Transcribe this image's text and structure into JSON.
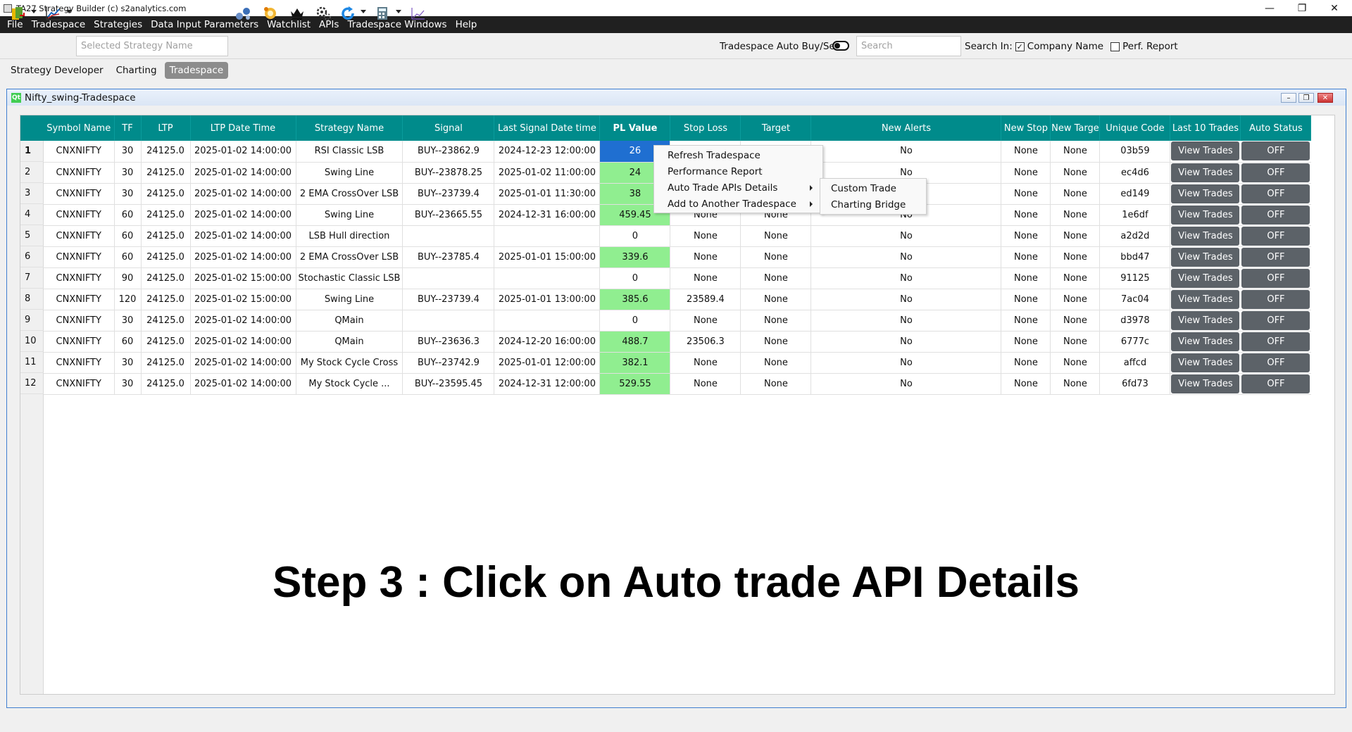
{
  "window": {
    "title": "TA27 Strategy Builder (c) s2analytics.com"
  },
  "menu": [
    "File",
    "Tradespace",
    "Strategies",
    "Data Input Parameters",
    "Watchlist",
    "APIs",
    "Tradespace Windows",
    "Help"
  ],
  "toolbar": {
    "strategy_placeholder": "Selected Strategy Name",
    "auto_label": "Tradespace Auto Buy/Sell:",
    "search_placeholder": "Search",
    "search_in_label": "Search In:",
    "company_name_label": "Company Name",
    "perf_report_label": "Perf. Report"
  },
  "tabs": [
    "Strategy Developer",
    "Charting",
    "Tradespace"
  ],
  "subwindow": {
    "title": "Nifty_swing-Tradespace"
  },
  "columns": [
    "Symbol Name",
    "TF",
    "LTP",
    "LTP Date Time",
    "Strategy Name",
    "Signal",
    "Last Signal Date time",
    "PL Value",
    "Stop Loss",
    "Target",
    "New Alerts",
    "New Stop",
    "New Targe",
    "Unique Code",
    "Last 10 Trades",
    "Auto Status"
  ],
  "rows": [
    {
      "n": "1",
      "sym": "CNXNIFTY",
      "tf": "30",
      "ltp": "24125.0",
      "ltpdt": "2025-01-02 14:00:00",
      "strat": "RSI Classic LSB",
      "sig": "BUY--23862.9",
      "lsdt": "2024-12-23 12:00:00",
      "pl": "26",
      "sl": "",
      "tg": "",
      "alert": "No",
      "nstop": "None",
      "ntarget": "None",
      "code": "03b59",
      "trades": "View Trades",
      "auto": "OFF"
    },
    {
      "n": "2",
      "sym": "CNXNIFTY",
      "tf": "30",
      "ltp": "24125.0",
      "ltpdt": "2025-01-02 14:00:00",
      "strat": "Swing Line",
      "sig": "BUY--23878.25",
      "lsdt": "2025-01-02 11:00:00",
      "pl": "24",
      "sl": "",
      "tg": "",
      "alert": "No",
      "nstop": "None",
      "ntarget": "None",
      "code": "ec4d6",
      "trades": "View Trades",
      "auto": "OFF"
    },
    {
      "n": "3",
      "sym": "CNXNIFTY",
      "tf": "30",
      "ltp": "24125.0",
      "ltpdt": "2025-01-02 14:00:00",
      "strat": "2 EMA CrossOver LSB",
      "sig": "BUY--23739.4",
      "lsdt": "2025-01-01 11:30:00",
      "pl": "38",
      "sl": "",
      "tg": "",
      "alert": "o",
      "nstop": "None",
      "ntarget": "None",
      "code": "ed149",
      "trades": "View Trades",
      "auto": "OFF"
    },
    {
      "n": "4",
      "sym": "CNXNIFTY",
      "tf": "60",
      "ltp": "24125.0",
      "ltpdt": "2025-01-02 14:00:00",
      "strat": "Swing Line",
      "sig": "BUY--23665.55",
      "lsdt": "2024-12-31 16:00:00",
      "pl": "459.45",
      "sl": "None",
      "tg": "None",
      "alert": "No",
      "nstop": "None",
      "ntarget": "None",
      "code": "1e6df",
      "trades": "View Trades",
      "auto": "OFF"
    },
    {
      "n": "5",
      "sym": "CNXNIFTY",
      "tf": "60",
      "ltp": "24125.0",
      "ltpdt": "2025-01-02 14:00:00",
      "strat": "LSB Hull direction",
      "sig": "",
      "lsdt": "",
      "pl": "0",
      "sl": "None",
      "tg": "None",
      "alert": "No",
      "nstop": "None",
      "ntarget": "None",
      "code": "a2d2d",
      "trades": "View Trades",
      "auto": "OFF"
    },
    {
      "n": "6",
      "sym": "CNXNIFTY",
      "tf": "60",
      "ltp": "24125.0",
      "ltpdt": "2025-01-02 14:00:00",
      "strat": "2 EMA CrossOver LSB",
      "sig": "BUY--23785.4",
      "lsdt": "2025-01-01 15:00:00",
      "pl": "339.6",
      "sl": "None",
      "tg": "None",
      "alert": "No",
      "nstop": "None",
      "ntarget": "None",
      "code": "bbd47",
      "trades": "View Trades",
      "auto": "OFF"
    },
    {
      "n": "7",
      "sym": "CNXNIFTY",
      "tf": "90",
      "ltp": "24125.0",
      "ltpdt": "2025-01-02 15:00:00",
      "strat": "Stochastic Classic LSB",
      "sig": "",
      "lsdt": "",
      "pl": "0",
      "sl": "None",
      "tg": "None",
      "alert": "No",
      "nstop": "None",
      "ntarget": "None",
      "code": "91125",
      "trades": "View Trades",
      "auto": "OFF"
    },
    {
      "n": "8",
      "sym": "CNXNIFTY",
      "tf": "120",
      "ltp": "24125.0",
      "ltpdt": "2025-01-02 15:00:00",
      "strat": "Swing Line",
      "sig": "BUY--23739.4",
      "lsdt": "2025-01-01 13:00:00",
      "pl": "385.6",
      "sl": "23589.4",
      "tg": "None",
      "alert": "No",
      "nstop": "None",
      "ntarget": "None",
      "code": "7ac04",
      "trades": "View Trades",
      "auto": "OFF"
    },
    {
      "n": "9",
      "sym": "CNXNIFTY",
      "tf": "30",
      "ltp": "24125.0",
      "ltpdt": "2025-01-02 14:00:00",
      "strat": "QMain",
      "sig": "",
      "lsdt": "",
      "pl": "0",
      "sl": "None",
      "tg": "None",
      "alert": "No",
      "nstop": "None",
      "ntarget": "None",
      "code": "d3978",
      "trades": "View Trades",
      "auto": "OFF"
    },
    {
      "n": "10",
      "sym": "CNXNIFTY",
      "tf": "60",
      "ltp": "24125.0",
      "ltpdt": "2025-01-02 14:00:00",
      "strat": "QMain",
      "sig": "BUY--23636.3",
      "lsdt": "2024-12-20 16:00:00",
      "pl": "488.7",
      "sl": "23506.3",
      "tg": "None",
      "alert": "No",
      "nstop": "None",
      "ntarget": "None",
      "code": "6777c",
      "trades": "View Trades",
      "auto": "OFF"
    },
    {
      "n": "11",
      "sym": "CNXNIFTY",
      "tf": "30",
      "ltp": "24125.0",
      "ltpdt": "2025-01-02 14:00:00",
      "strat": "My Stock Cycle Cross",
      "sig": "BUY--23742.9",
      "lsdt": "2025-01-01 12:00:00",
      "pl": "382.1",
      "sl": "None",
      "tg": "None",
      "alert": "No",
      "nstop": "None",
      "ntarget": "None",
      "code": "affcd",
      "trades": "View Trades",
      "auto": "OFF"
    },
    {
      "n": "12",
      "sym": "CNXNIFTY",
      "tf": "30",
      "ltp": "24125.0",
      "ltpdt": "2025-01-02 14:00:00",
      "strat": "My Stock Cycle ...",
      "sig": "BUY--23595.45",
      "lsdt": "2024-12-31 12:00:00",
      "pl": "529.55",
      "sl": "None",
      "tg": "None",
      "alert": "No",
      "nstop": "None",
      "ntarget": "None",
      "code": "6fd73",
      "trades": "View Trades",
      "auto": "OFF"
    }
  ],
  "context_menu": {
    "items": [
      "Refresh Tradespace",
      "Performance Report",
      "Auto Trade APIs Details",
      "Add to Another Tradespace"
    ],
    "submenu": [
      "Custom Trade",
      "Charting Bridge"
    ]
  },
  "caption": "Step 3 : Click on Auto trade API Details",
  "colors": {
    "header_teal": "#008b8b",
    "pl_green": "#90ee90",
    "selected_blue": "#1f6fd1",
    "button_gray": "#5c6268",
    "menubar": "#202020"
  }
}
